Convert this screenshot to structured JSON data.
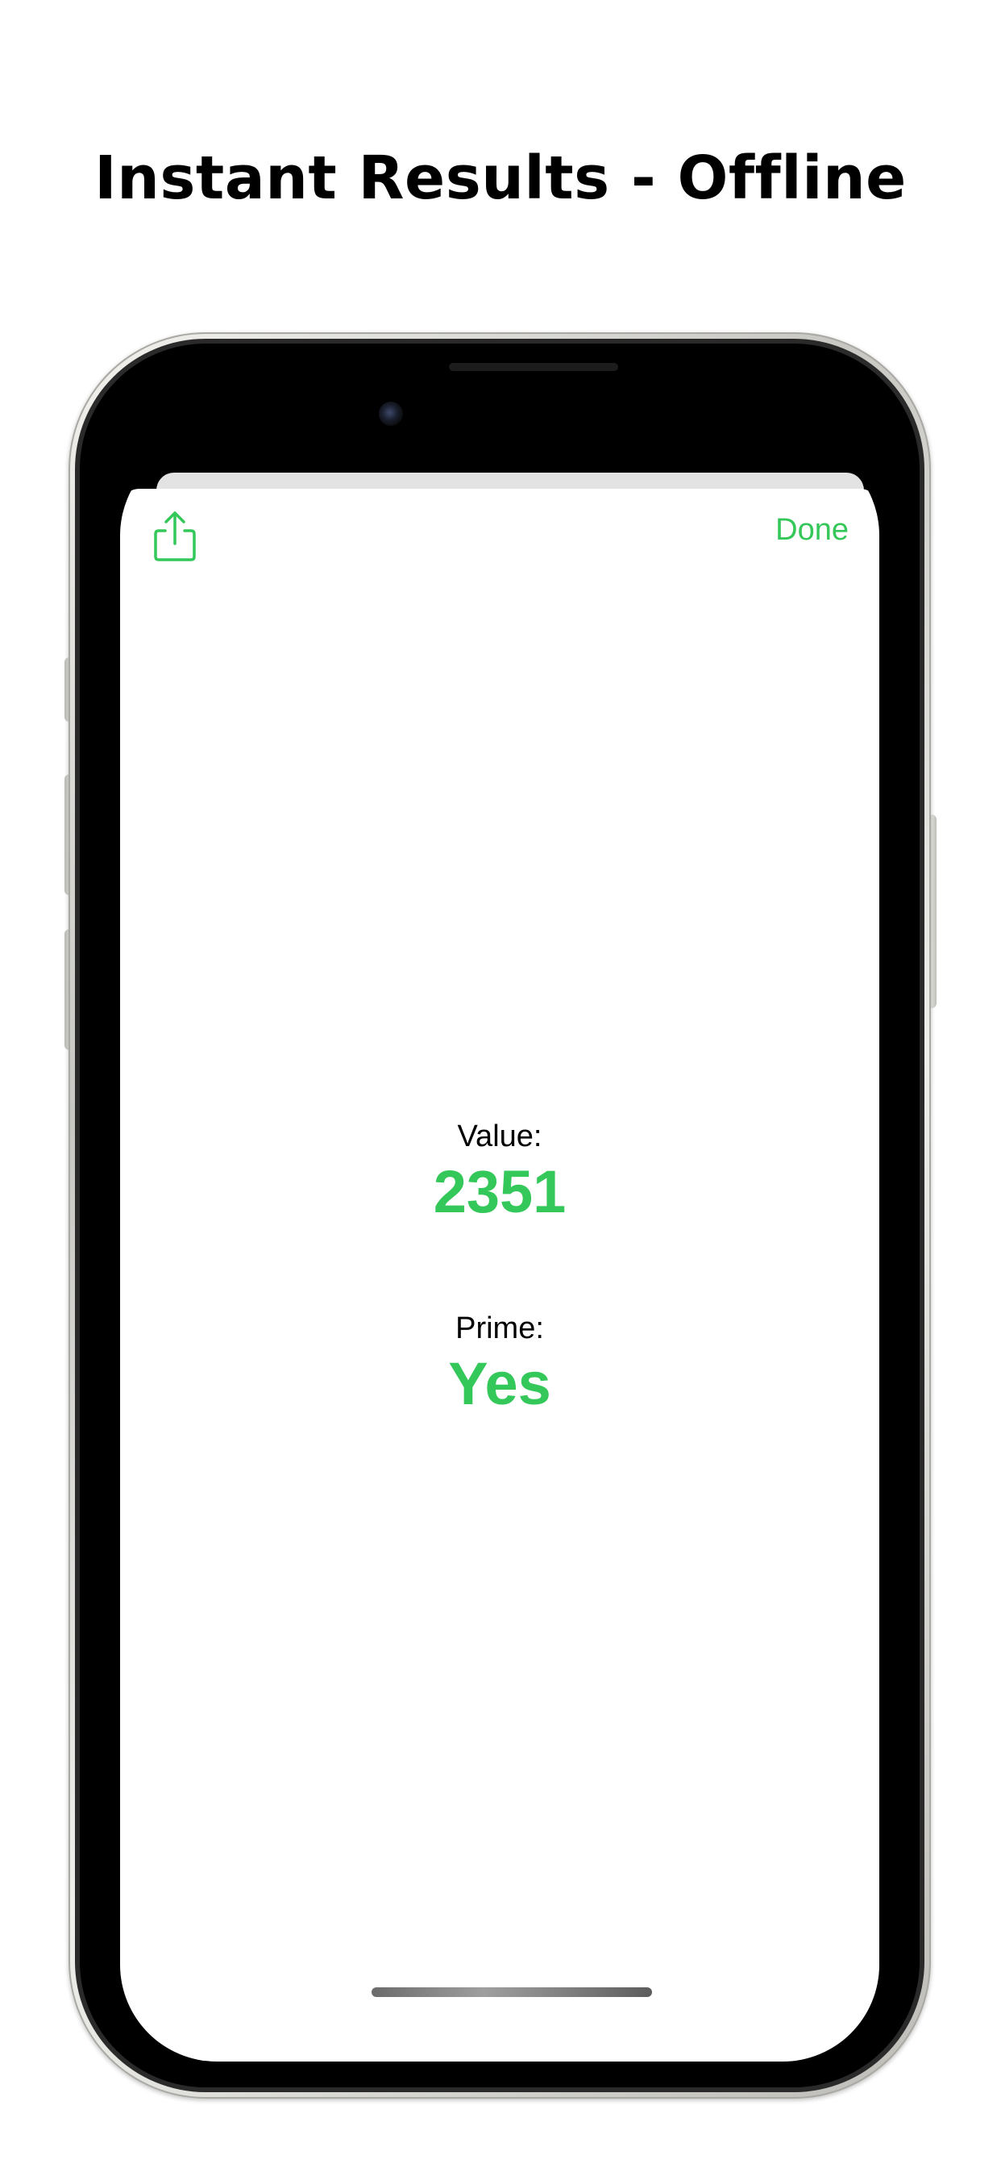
{
  "headline": "Instant Results - Offline",
  "sheet": {
    "share_icon": "share-icon",
    "done_label": "Done",
    "value_label": "Value:",
    "value": "2351",
    "prime_label": "Prime:",
    "prime_value": "Yes"
  },
  "colors": {
    "accent": "#34c759",
    "background": "#ffffff",
    "text": "#000000"
  }
}
